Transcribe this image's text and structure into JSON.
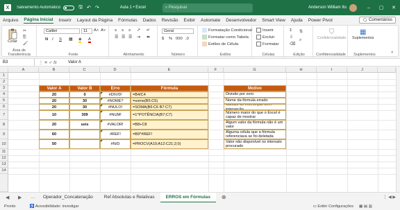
{
  "titlebar": {
    "autosave_label": "Salvamento Automático",
    "doc_title": "Aula 1  •  Excel",
    "search_placeholder": "Pesquisar",
    "user_name": "Anderson William Ito"
  },
  "tabs": [
    "Arquivo",
    "Página Inicial",
    "Inserir",
    "Layout da Página",
    "Fórmulas",
    "Dados",
    "Revisão",
    "Exibir",
    "Automate",
    "Desenvolvedor",
    "Smart View",
    "Ajuda",
    "Power Pivot"
  ],
  "active_tab": "Página Inicial",
  "comments_label": "Comentários",
  "ribbon": {
    "clipboard": {
      "paste": "Colar",
      "label": "Área de Transferência"
    },
    "font": {
      "name": "Calibri",
      "size": "11",
      "label": "Fonte"
    },
    "alignment": {
      "label": "Alinhamento"
    },
    "number": {
      "format": "Geral",
      "label": "Número"
    },
    "styles": {
      "conditional": "Formatação Condicional",
      "as_table": "Formatar como Tabela",
      "cell_styles": "Estilos de Célula",
      "label": "Estilos"
    },
    "cells": {
      "insert": "Inserir",
      "delete": "Excluir",
      "format": "Formatar",
      "label": "Células"
    },
    "editing": {
      "label": "Edição"
    },
    "confidentiality": {
      "button": "Confidencialidade",
      "label": "Confidencialidade"
    },
    "addins": {
      "button": "Suplementos",
      "label": "Suplementos"
    }
  },
  "formula_bar": {
    "name_box": "B3",
    "content": "Valor A"
  },
  "columns": [
    "A",
    "B",
    "C",
    "D",
    "E",
    "F",
    "G",
    "H",
    "I",
    "J"
  ],
  "rows": [
    "1",
    "2",
    "3",
    "4",
    "5",
    "6",
    "7",
    "8",
    "9",
    "10",
    "11",
    "12",
    "13",
    "14"
  ],
  "table": {
    "headers": [
      "Valor A",
      "Valor B",
      "Erro",
      "Fórmula"
    ],
    "rows": [
      [
        "20",
        "0",
        "#DIV/0!",
        "=B4/C4"
      ],
      [
        "20",
        "30",
        "#NOME?",
        "=some(B5:C5)"
      ],
      [
        "20",
        "30",
        "#NULO!",
        "=SOMA(B6:C6 B7:C7)"
      ],
      [
        "10",
        "309",
        "#NUM!",
        "=1^POTÊNCIA(B7;C7)"
      ],
      [
        "20",
        "seis",
        "#VALOR!",
        "=B8+C8"
      ],
      [
        "60",
        "",
        "#REF!",
        "=B9*#REF!"
      ],
      [
        "50",
        "",
        "#N/D",
        "=PROCV(A10;A12:C21;2;0)"
      ]
    ]
  },
  "motivo": {
    "header": "Motivo",
    "items": [
      "Divisão por zero",
      "Nome da fórmula errado",
      "Cálculo de interseção sem interseção",
      "Número maior do que o Excel é capaz de mostrar",
      "Algum valor da fórmula não é um valor",
      "Alguma célula que a fórmula referenciava se foi deletada",
      "Valor não disponível no intervalo procurado"
    ]
  },
  "sheets": [
    "Operador_Concatenação",
    "Ref Absolutas e Relativas",
    "ERROS em Fórmulas"
  ],
  "active_sheet": "ERROS em Fórmulas",
  "status": {
    "ready": "Pronto",
    "accessibility": "Acessibilidade: investigar",
    "display_settings": "Exibir Configurações"
  },
  "colors": {
    "brand": "#1e7145",
    "table_header": "#c55a11",
    "formula_fill": "#fff2cc"
  }
}
